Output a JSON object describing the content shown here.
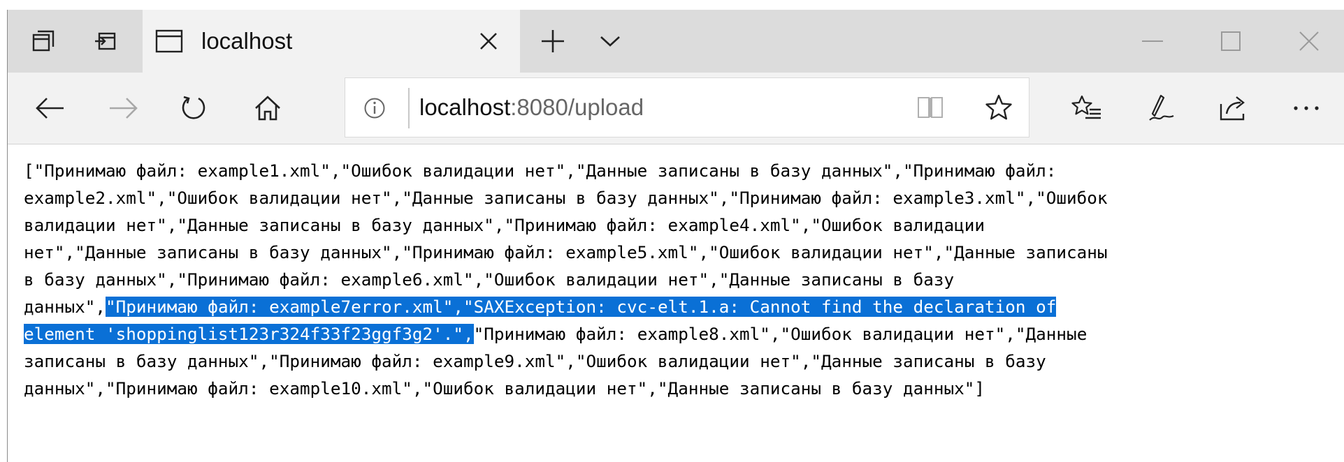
{
  "tab": {
    "title": "localhost"
  },
  "address": {
    "host": "localhost",
    "path": ":8080/upload"
  },
  "icons": {
    "tab_manager": "tabs-aside-icon",
    "set_aside": "set-tabs-aside-icon",
    "tab_favicon": "page-icon",
    "close_tab": "close-icon",
    "new_tab": "plus-icon",
    "tab_preview": "chevron-down-icon",
    "minimize": "minimize-icon",
    "maximize": "maximize-icon",
    "close_window": "close-icon",
    "back": "arrow-left-icon",
    "forward": "arrow-right-icon",
    "refresh": "refresh-icon",
    "home": "home-icon",
    "info": "info-icon",
    "reading_view": "book-icon",
    "favorite": "star-icon",
    "favorites_hub": "favorites-list-icon",
    "notes": "pen-icon",
    "share": "share-icon",
    "more": "more-icon"
  },
  "content": {
    "lines": [
      {
        "before": "[\"Принимаю файл: example1.xml\",\"Ошибок валидации нет\",\"Данные записаны в базу данных\",\"Принимаю файл:",
        "selected": "",
        "after": ""
      },
      {
        "before": "example2.xml\",\"Ошибок валидации нет\",\"Данные записаны в базу данных\",\"Принимаю файл: example3.xml\",\"Ошибок",
        "selected": "",
        "after": ""
      },
      {
        "before": "валидации нет\",\"Данные записаны в базу данных\",\"Принимаю файл: example4.xml\",\"Ошибок валидации",
        "selected": "",
        "after": ""
      },
      {
        "before": "нет\",\"Данные записаны в базу данных\",\"Принимаю файл: example5.xml\",\"Ошибок валидации нет\",\"Данные записаны",
        "selected": "",
        "after": ""
      },
      {
        "before": "в базу данных\",\"Принимаю файл: example6.xml\",\"Ошибок валидации нет\",\"Данные записаны в базу",
        "selected": "",
        "after": ""
      },
      {
        "before": "данных\",",
        "selected": "\"Принимаю файл: example7error.xml\",\"SAXException: cvc-elt.1.a: Cannot find the declaration of",
        "after": ""
      },
      {
        "before": "",
        "selected": "element 'shoppinglist123r324f33f23ggf3g2'.\",",
        "after": "\"Принимаю файл: example8.xml\",\"Ошибок валидации нет\",\"Данные"
      },
      {
        "before": "записаны в базу данных\",\"Принимаю файл: example9.xml\",\"Ошибок валидации нет\",\"Данные записаны в базу",
        "selected": "",
        "after": ""
      },
      {
        "before": "данных\",\"Принимаю файл: example10.xml\",\"Ошибок валидации нет\",\"Данные записаны в базу данных\"]",
        "selected": "",
        "after": ""
      }
    ]
  }
}
